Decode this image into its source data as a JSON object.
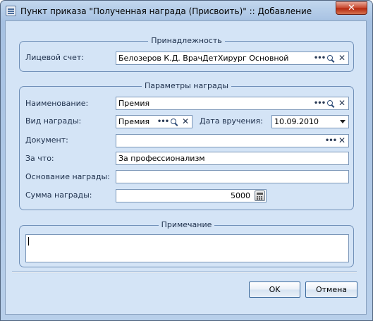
{
  "window": {
    "title": "Пункт приказа \"Полученная награда (Присвоить)\" :: Добавление",
    "close_label": "✕"
  },
  "group_affiliation": {
    "title": "Принадлежность",
    "account_label": "Лицевой счет:",
    "account_value": "Белозеров К.Д. ВрачДетХирург Основной"
  },
  "group_award": {
    "title": "Параметры награды",
    "name_label": "Наименование:",
    "name_value": "Премия",
    "type_label": "Вид награды:",
    "type_value": "Премия",
    "date_label": "Дата вручения:",
    "date_value": "10.09.2010",
    "document_label": "Документ:",
    "document_value": "",
    "reason_label": "За что:",
    "reason_value": "За профессионализм",
    "basis_label": "Основание награды:",
    "basis_value": "",
    "amount_label": "Сумма награды:",
    "amount_value": "5000"
  },
  "group_note": {
    "title": "Примечание",
    "value": ""
  },
  "buttons": {
    "ok": "OK",
    "cancel": "Отмена"
  },
  "icons": {
    "ellipsis": "•••",
    "search": "search-icon",
    "clear": "✕"
  }
}
